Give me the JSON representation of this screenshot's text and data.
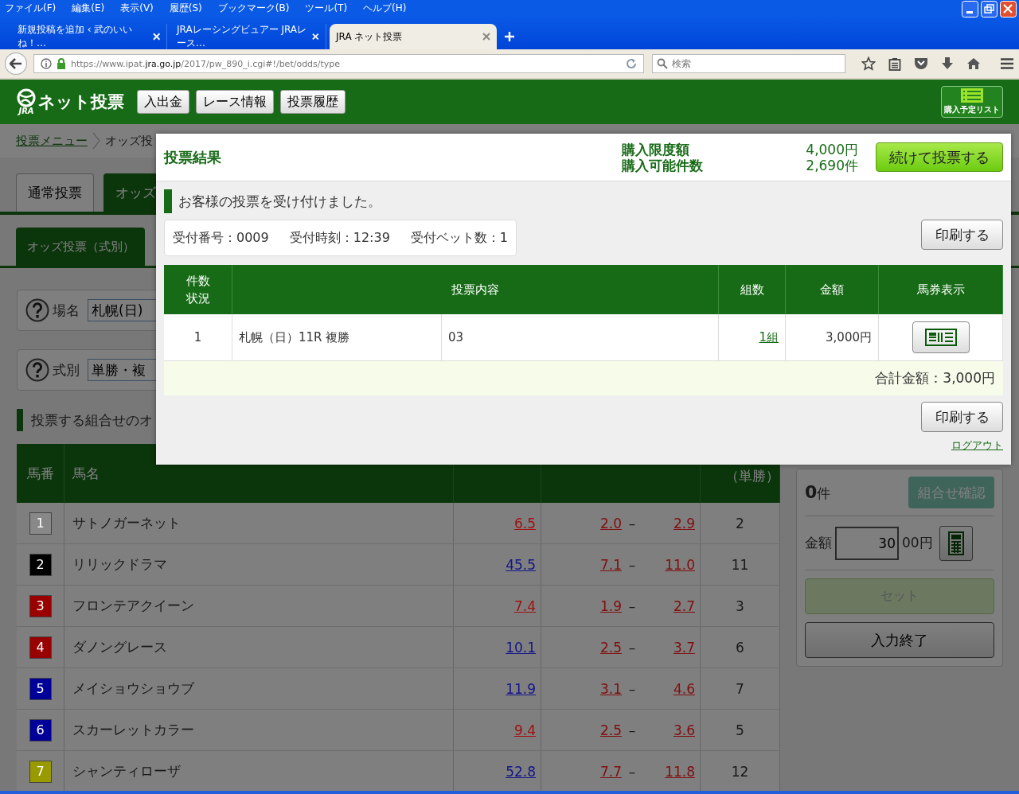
{
  "browser": {
    "menu": [
      "ファイル(F)",
      "編集(E)",
      "表示(V)",
      "履歴(S)",
      "ブックマーク(B)",
      "ツール(T)",
      "ヘルプ(H)"
    ],
    "tabs": [
      {
        "title": "新規投稿を追加 ‹ 武のいいね！…",
        "selected": false
      },
      {
        "title": "JRAレーシングビュアー JRAレース…",
        "selected": false
      },
      {
        "title": "JRA  ネット投票",
        "selected": true
      }
    ],
    "url": {
      "prefix": "https://www.ipat.",
      "domain": "jra.go.jp",
      "path": "/2017/pw_890_i.cgi#!/bet/odds/type"
    },
    "search": {
      "placeholder": "検索"
    }
  },
  "header": {
    "logo_text": "ネット投票",
    "logo_mark": "JRA",
    "nav": [
      "入出金",
      "レース情報",
      "投票履歴"
    ],
    "list_button": "購入予定リスト"
  },
  "breadcrumb": [
    {
      "label": "投票メニュー",
      "kind": "link"
    },
    {
      "label": "オッズ投",
      "kind": "current"
    }
  ],
  "tabs": [
    {
      "label": "通常投票",
      "selected": false
    },
    {
      "label": "オッズ",
      "selected": true
    }
  ],
  "subtabs": [
    {
      "label": "オッズ投票（式別）",
      "selected": true
    }
  ],
  "fields": [
    {
      "label": "場名",
      "value": "札幌(日)"
    },
    {
      "label": "式別",
      "value": "単勝・複"
    }
  ],
  "section_title": "投票する組合せのオ",
  "horses": {
    "columns": [
      "馬番",
      "馬名",
      "（単勝）"
    ],
    "rows": [
      {
        "number": "1",
        "color": "#888888",
        "name": "サトノガーネット",
        "win": {
          "value": "6.5",
          "color": "#a01010"
        },
        "place_low": "2.0",
        "sep": "–",
        "place_high": "2.9",
        "popularity": "2"
      },
      {
        "number": "2",
        "color": "#000000",
        "name": "リリックドラマ",
        "win": {
          "value": "45.5",
          "color": "#14148a"
        },
        "place_low": "7.1",
        "sep": "–",
        "place_high": "11.0",
        "popularity": "11"
      },
      {
        "number": "3",
        "color": "#990000",
        "name": "フロンテアクイーン",
        "win": {
          "value": "7.4",
          "color": "#a01010"
        },
        "place_low": "1.9",
        "sep": "–",
        "place_high": "2.7",
        "popularity": "3"
      },
      {
        "number": "4",
        "color": "#990000",
        "name": "ダノングレース",
        "win": {
          "value": "10.1",
          "color": "#14148a"
        },
        "place_low": "2.5",
        "sep": "–",
        "place_high": "3.7",
        "popularity": "6"
      },
      {
        "number": "5",
        "color": "#000099",
        "name": "メイショウショウブ",
        "win": {
          "value": "11.9",
          "color": "#14148a"
        },
        "place_low": "3.1",
        "sep": "–",
        "place_high": "4.6",
        "popularity": "7"
      },
      {
        "number": "6",
        "color": "#000099",
        "name": "スカーレットカラー",
        "win": {
          "value": "9.4",
          "color": "#a01010"
        },
        "place_low": "2.5",
        "sep": "–",
        "place_high": "3.6",
        "popularity": "5"
      },
      {
        "number": "7",
        "color": "#999900",
        "name": "シャンティローザ",
        "win": {
          "value": "52.8",
          "color": "#14148a"
        },
        "place_low": "7.7",
        "sep": "–",
        "place_high": "11.8",
        "popularity": "12"
      }
    ]
  },
  "selection": {
    "count": "0",
    "count_unit": "件",
    "confirm_button": "組合せ確認",
    "amount_label": "金額",
    "amount_value": "30",
    "amount_suffix": "00円",
    "set_button": {
      "label": "セット",
      "disabled": true
    },
    "finish_button": "入力終了"
  },
  "dialog": {
    "title": "投票結果",
    "limits": [
      {
        "label": "購入限度額",
        "value": "4,000円"
      },
      {
        "label": "購入可能件数",
        "value": "2,690件"
      }
    ],
    "continue_button": "続けて投票する",
    "message": "お客様の投票を受け付けました。",
    "receipt": [
      "受付番号：0009",
      "受付時刻：12:39",
      "受付ベット数：1"
    ],
    "print_buttons": [
      "印刷する",
      "印刷する"
    ],
    "columns": [
      "件数状況",
      "投票内容",
      "組数",
      "金額",
      "馬券表示"
    ],
    "rows": [
      {
        "count": "1",
        "race": "札幌（日）11R  複勝",
        "horses": "03",
        "combos": "1組",
        "amount": "3,000円"
      }
    ],
    "total": "合計金額：3,000円",
    "logout": "ログアウト"
  }
}
